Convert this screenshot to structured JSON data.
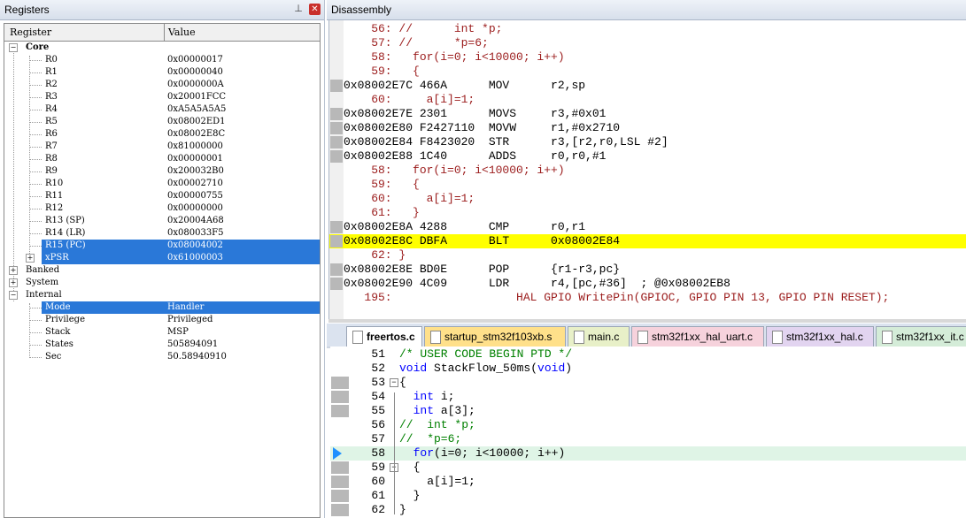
{
  "registers": {
    "title": "Registers",
    "col_register": "Register",
    "col_value": "Value",
    "groups": {
      "core": "Core",
      "banked": "Banked",
      "system": "System",
      "internal": "Internal"
    },
    "core_rows": [
      {
        "name": "R0",
        "value": "0x00000017"
      },
      {
        "name": "R1",
        "value": "0x00000040"
      },
      {
        "name": "R2",
        "value": "0x0000000A"
      },
      {
        "name": "R3",
        "value": "0x20001FCC"
      },
      {
        "name": "R4",
        "value": "0xA5A5A5A5"
      },
      {
        "name": "R5",
        "value": "0x08002ED1"
      },
      {
        "name": "R6",
        "value": "0x08002E8C"
      },
      {
        "name": "R7",
        "value": "0x81000000"
      },
      {
        "name": "R8",
        "value": "0x00000001"
      },
      {
        "name": "R9",
        "value": "0x200032B0"
      },
      {
        "name": "R10",
        "value": "0x00002710"
      },
      {
        "name": "R11",
        "value": "0x00000755"
      },
      {
        "name": "R12",
        "value": "0x00000000"
      },
      {
        "name": "R13 (SP)",
        "value": "0x20004A68"
      },
      {
        "name": "R14 (LR)",
        "value": "0x080033F5"
      },
      {
        "name": "R15 (PC)",
        "value": "0x08004002"
      },
      {
        "name": "xPSR",
        "value": "0x61000003"
      }
    ],
    "internal_rows": [
      {
        "name": "Mode",
        "value": "Handler"
      },
      {
        "name": "Privilege",
        "value": "Privileged"
      },
      {
        "name": "Stack",
        "value": "MSP"
      },
      {
        "name": "States",
        "value": "505894091"
      },
      {
        "name": "Sec",
        "value": "50.58940910"
      }
    ]
  },
  "disassembly": {
    "title": "Disassembly",
    "lines": [
      {
        "kind": "src",
        "text": "    56: //      int *p;"
      },
      {
        "kind": "src",
        "text": "    57: //      *p=6;"
      },
      {
        "kind": "src",
        "text": "    58:   for(i=0; i<10000; i++)"
      },
      {
        "kind": "src",
        "text": "    59:   {"
      },
      {
        "kind": "asm",
        "text": "0x08002E7C 466A      MOV      r2,sp"
      },
      {
        "kind": "src",
        "text": "    60:     a[i]=1;"
      },
      {
        "kind": "asm",
        "text": "0x08002E7E 2301      MOVS     r3,#0x01"
      },
      {
        "kind": "asm",
        "text": "0x08002E80 F2427110  MOVW     r1,#0x2710"
      },
      {
        "kind": "asm",
        "text": "0x08002E84 F8423020  STR      r3,[r2,r0,LSL #2]"
      },
      {
        "kind": "asm",
        "text": "0x08002E88 1C40      ADDS     r0,r0,#1"
      },
      {
        "kind": "src",
        "text": "    58:   for(i=0; i<10000; i++)"
      },
      {
        "kind": "src",
        "text": "    59:   {"
      },
      {
        "kind": "src",
        "text": "    60:     a[i]=1;"
      },
      {
        "kind": "src",
        "text": "    61:   }"
      },
      {
        "kind": "asm",
        "text": "0x08002E8A 4288      CMP      r0,r1"
      },
      {
        "kind": "hl",
        "text": "0x08002E8C DBFA      BLT      0x08002E84"
      },
      {
        "kind": "src",
        "text": "    62: }"
      },
      {
        "kind": "asm",
        "text": "0x08002E8E BD0E      POP      {r1-r3,pc}"
      },
      {
        "kind": "asm",
        "text": "0x08002E90 4C09      LDR      r4,[pc,#36]  ; @0x08002EB8"
      },
      {
        "kind": "src",
        "text": "   195:                  HAL GPIO WritePin(GPIOC, GPIO PIN 13, GPIO PIN RESET);"
      }
    ]
  },
  "tabs": [
    {
      "label": "freertos.c",
      "color": "#ffffff",
      "active": true
    },
    {
      "label": "startup_stm32f103xb.s",
      "color": "#ffe08a",
      "active": false
    },
    {
      "label": "main.c",
      "color": "#e8f0c8",
      "active": false
    },
    {
      "label": "stm32f1xx_hal_uart.c",
      "color": "#f6d2dc",
      "active": false
    },
    {
      "label": "stm32f1xx_hal.c",
      "color": "#e2d4f0",
      "active": false
    },
    {
      "label": "stm32f1xx_it.c",
      "color": "#d4ecd8",
      "active": false
    }
  ],
  "editor": {
    "lines": [
      {
        "num": "51",
        "code": "/* USER CODE BEGIN PTD */"
      },
      {
        "num": "52",
        "code": "void StackFlow_50ms(void)"
      },
      {
        "num": "53",
        "code": "{"
      },
      {
        "num": "54",
        "code": "  int i;"
      },
      {
        "num": "55",
        "code": "  int a[3];"
      },
      {
        "num": "56",
        "code": "//  int *p;"
      },
      {
        "num": "57",
        "code": "//  *p=6;"
      },
      {
        "num": "58",
        "code": "  for(i=0; i<10000; i++)"
      },
      {
        "num": "59",
        "code": "  {"
      },
      {
        "num": "60",
        "code": "    a[i]=1;"
      },
      {
        "num": "61",
        "code": "  }"
      },
      {
        "num": "62",
        "code": "}"
      }
    ]
  },
  "colors": {
    "selection": "#2a78d8",
    "current_instruction": "#ffff00",
    "current_line": "#dff4e6",
    "source_text": "#9b1c1c",
    "keyword": "#0000ff",
    "comment": "#008000"
  }
}
